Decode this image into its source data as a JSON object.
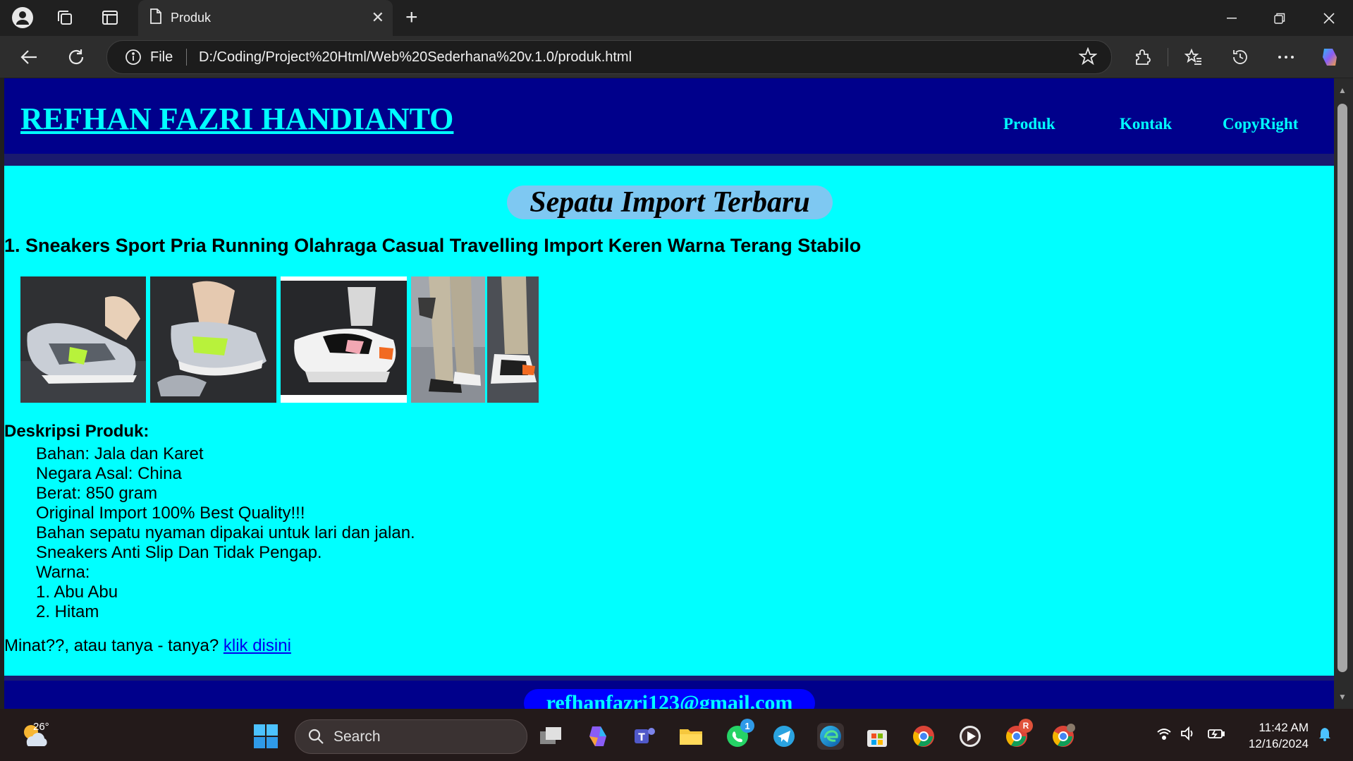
{
  "browser": {
    "tab_title": "Produk",
    "address_scheme": "File",
    "url": "D:/Coding/Project%20Html/Web%20Sederhana%20v.1.0/produk.html"
  },
  "site": {
    "title": "REFHAN FAZRI HANDIANTO",
    "nav": [
      "Produk",
      "Kontak",
      "CopyRight"
    ],
    "heading": "Sepatu Import Terbaru",
    "product_title": "1. Sneakers Sport Pria Running Olahraga Casual Travelling Import Keren Warna Terang Stabilo",
    "desc_label": "Deskripsi Produk:",
    "desc_lines": [
      "Bahan: Jala dan Karet",
      "Negara Asal: China",
      "Berat: 850 gram",
      "Original Import 100% Best Quality!!!",
      "Bahan sepatu nyaman dipakai untuk lari dan jalan.",
      "Sneakers Anti Slip Dan Tidak Pengap.",
      "Warna:",
      "1. Abu Abu",
      "2. Hitam"
    ],
    "cta_text": "Minat??, atau tanya - tanya? ",
    "cta_link": "klik disini",
    "footer_email": "refhanfazri123@gmail.com",
    "colors": {
      "bg": "#00ffff",
      "header": "#00008b",
      "pill": "#7ec8f2",
      "email_pill": "#0000ff"
    }
  },
  "taskbar": {
    "weather_temp": "26°",
    "search_placeholder": "Search",
    "whatsapp_badge": "1",
    "chrome_profile_badge": "R",
    "time": "11:42 AM",
    "date": "12/16/2024"
  }
}
